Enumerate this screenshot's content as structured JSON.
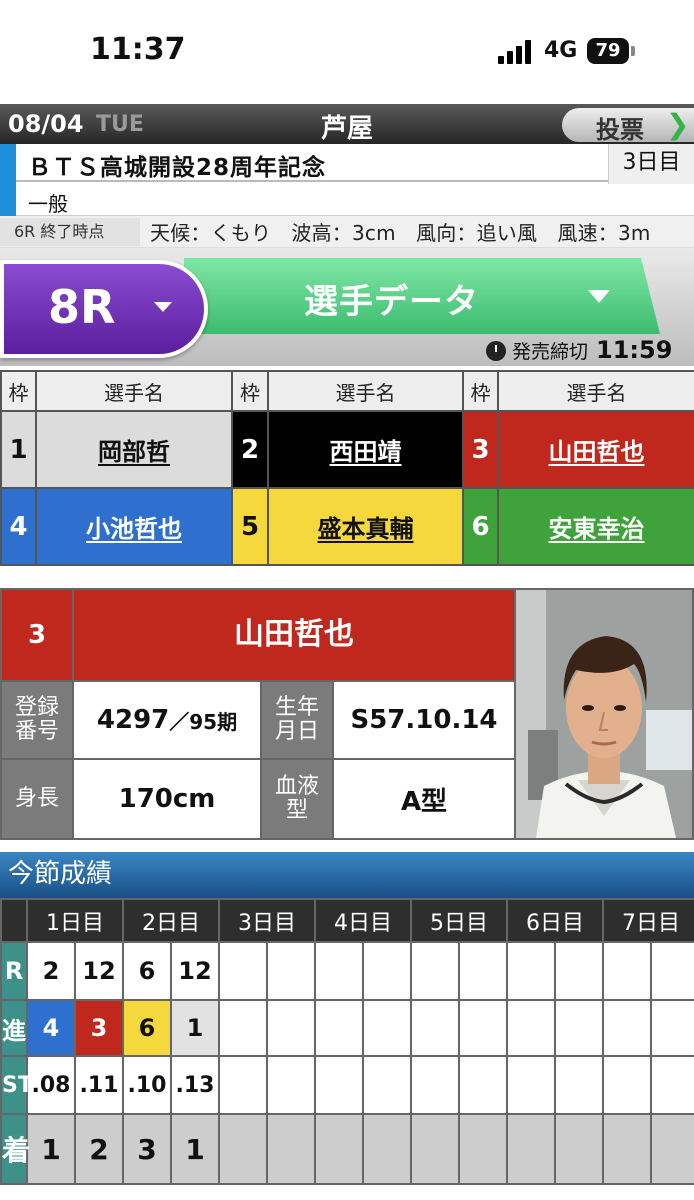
{
  "status": {
    "time": "11:37",
    "network": "4G",
    "battery": "79"
  },
  "header": {
    "date": "08/04",
    "weekday": "TUE",
    "venue": "芦屋",
    "vote_label": "投票",
    "vote_arrow": "❯"
  },
  "race_info": {
    "title": "ＢＴＳ高城開設28周年記念",
    "day": "3日目",
    "grade": "一般"
  },
  "weather": {
    "label": "6R 終了時点",
    "text": "天候：くもり　波高：3cm　風向：追い風　風速：3m"
  },
  "race_selector": {
    "race": "8R",
    "tab": "選手データ"
  },
  "deadline": {
    "label": "発売締切",
    "time": "11:59"
  },
  "entry": {
    "headers": {
      "frame": "枠",
      "name": "選手名"
    },
    "racers": [
      {
        "no": "1",
        "name": "岡部哲",
        "bg": "#dcdcdc",
        "fg": "#111111"
      },
      {
        "no": "2",
        "name": "西田靖",
        "bg": "#000000",
        "fg": "#ffffff"
      },
      {
        "no": "3",
        "name": "山田哲也",
        "bg": "#c0281e",
        "fg": "#ffffff"
      },
      {
        "no": "4",
        "name": "小池哲也",
        "bg": "#2f6fce",
        "fg": "#ffffff"
      },
      {
        "no": "5",
        "name": "盛本真輔",
        "bg": "#f5d83c",
        "fg": "#111111"
      },
      {
        "no": "6",
        "name": "安東幸治",
        "bg": "#3fa23a",
        "fg": "#ffffff"
      }
    ]
  },
  "racer_card": {
    "no": "3",
    "name": "山田哲也",
    "reg_label": "登録\n番号",
    "reg_no": "4297",
    "term": "／95期",
    "birth_label": "生年\n月日",
    "birth": "S57.10.14",
    "height_label": "身長",
    "height": "170cm",
    "blood_label": "血液\n型",
    "blood": "A型"
  },
  "results": {
    "title": "今節成績",
    "days": [
      "1日目",
      "2日目",
      "3日目",
      "4日目",
      "5日目",
      "6日目",
      "7日目"
    ],
    "row_labels": {
      "race": "R",
      "course": "進",
      "st": "ST",
      "finish": "着"
    },
    "races": [
      "2",
      "12",
      "6",
      "12"
    ],
    "courses": [
      {
        "v": "4",
        "bg": "#2f6fce",
        "fg": "#ffffff"
      },
      {
        "v": "3",
        "bg": "#c0281e",
        "fg": "#ffffff"
      },
      {
        "v": "6",
        "bg": "#f5d83c",
        "fg": "#111111"
      },
      {
        "v": "1",
        "bg": "#e2e2e2",
        "fg": "#111111"
      }
    ],
    "st": [
      ".08",
      ".11",
      ".10",
      ".13"
    ],
    "finishes": [
      "1",
      "2",
      "3",
      "1"
    ]
  }
}
